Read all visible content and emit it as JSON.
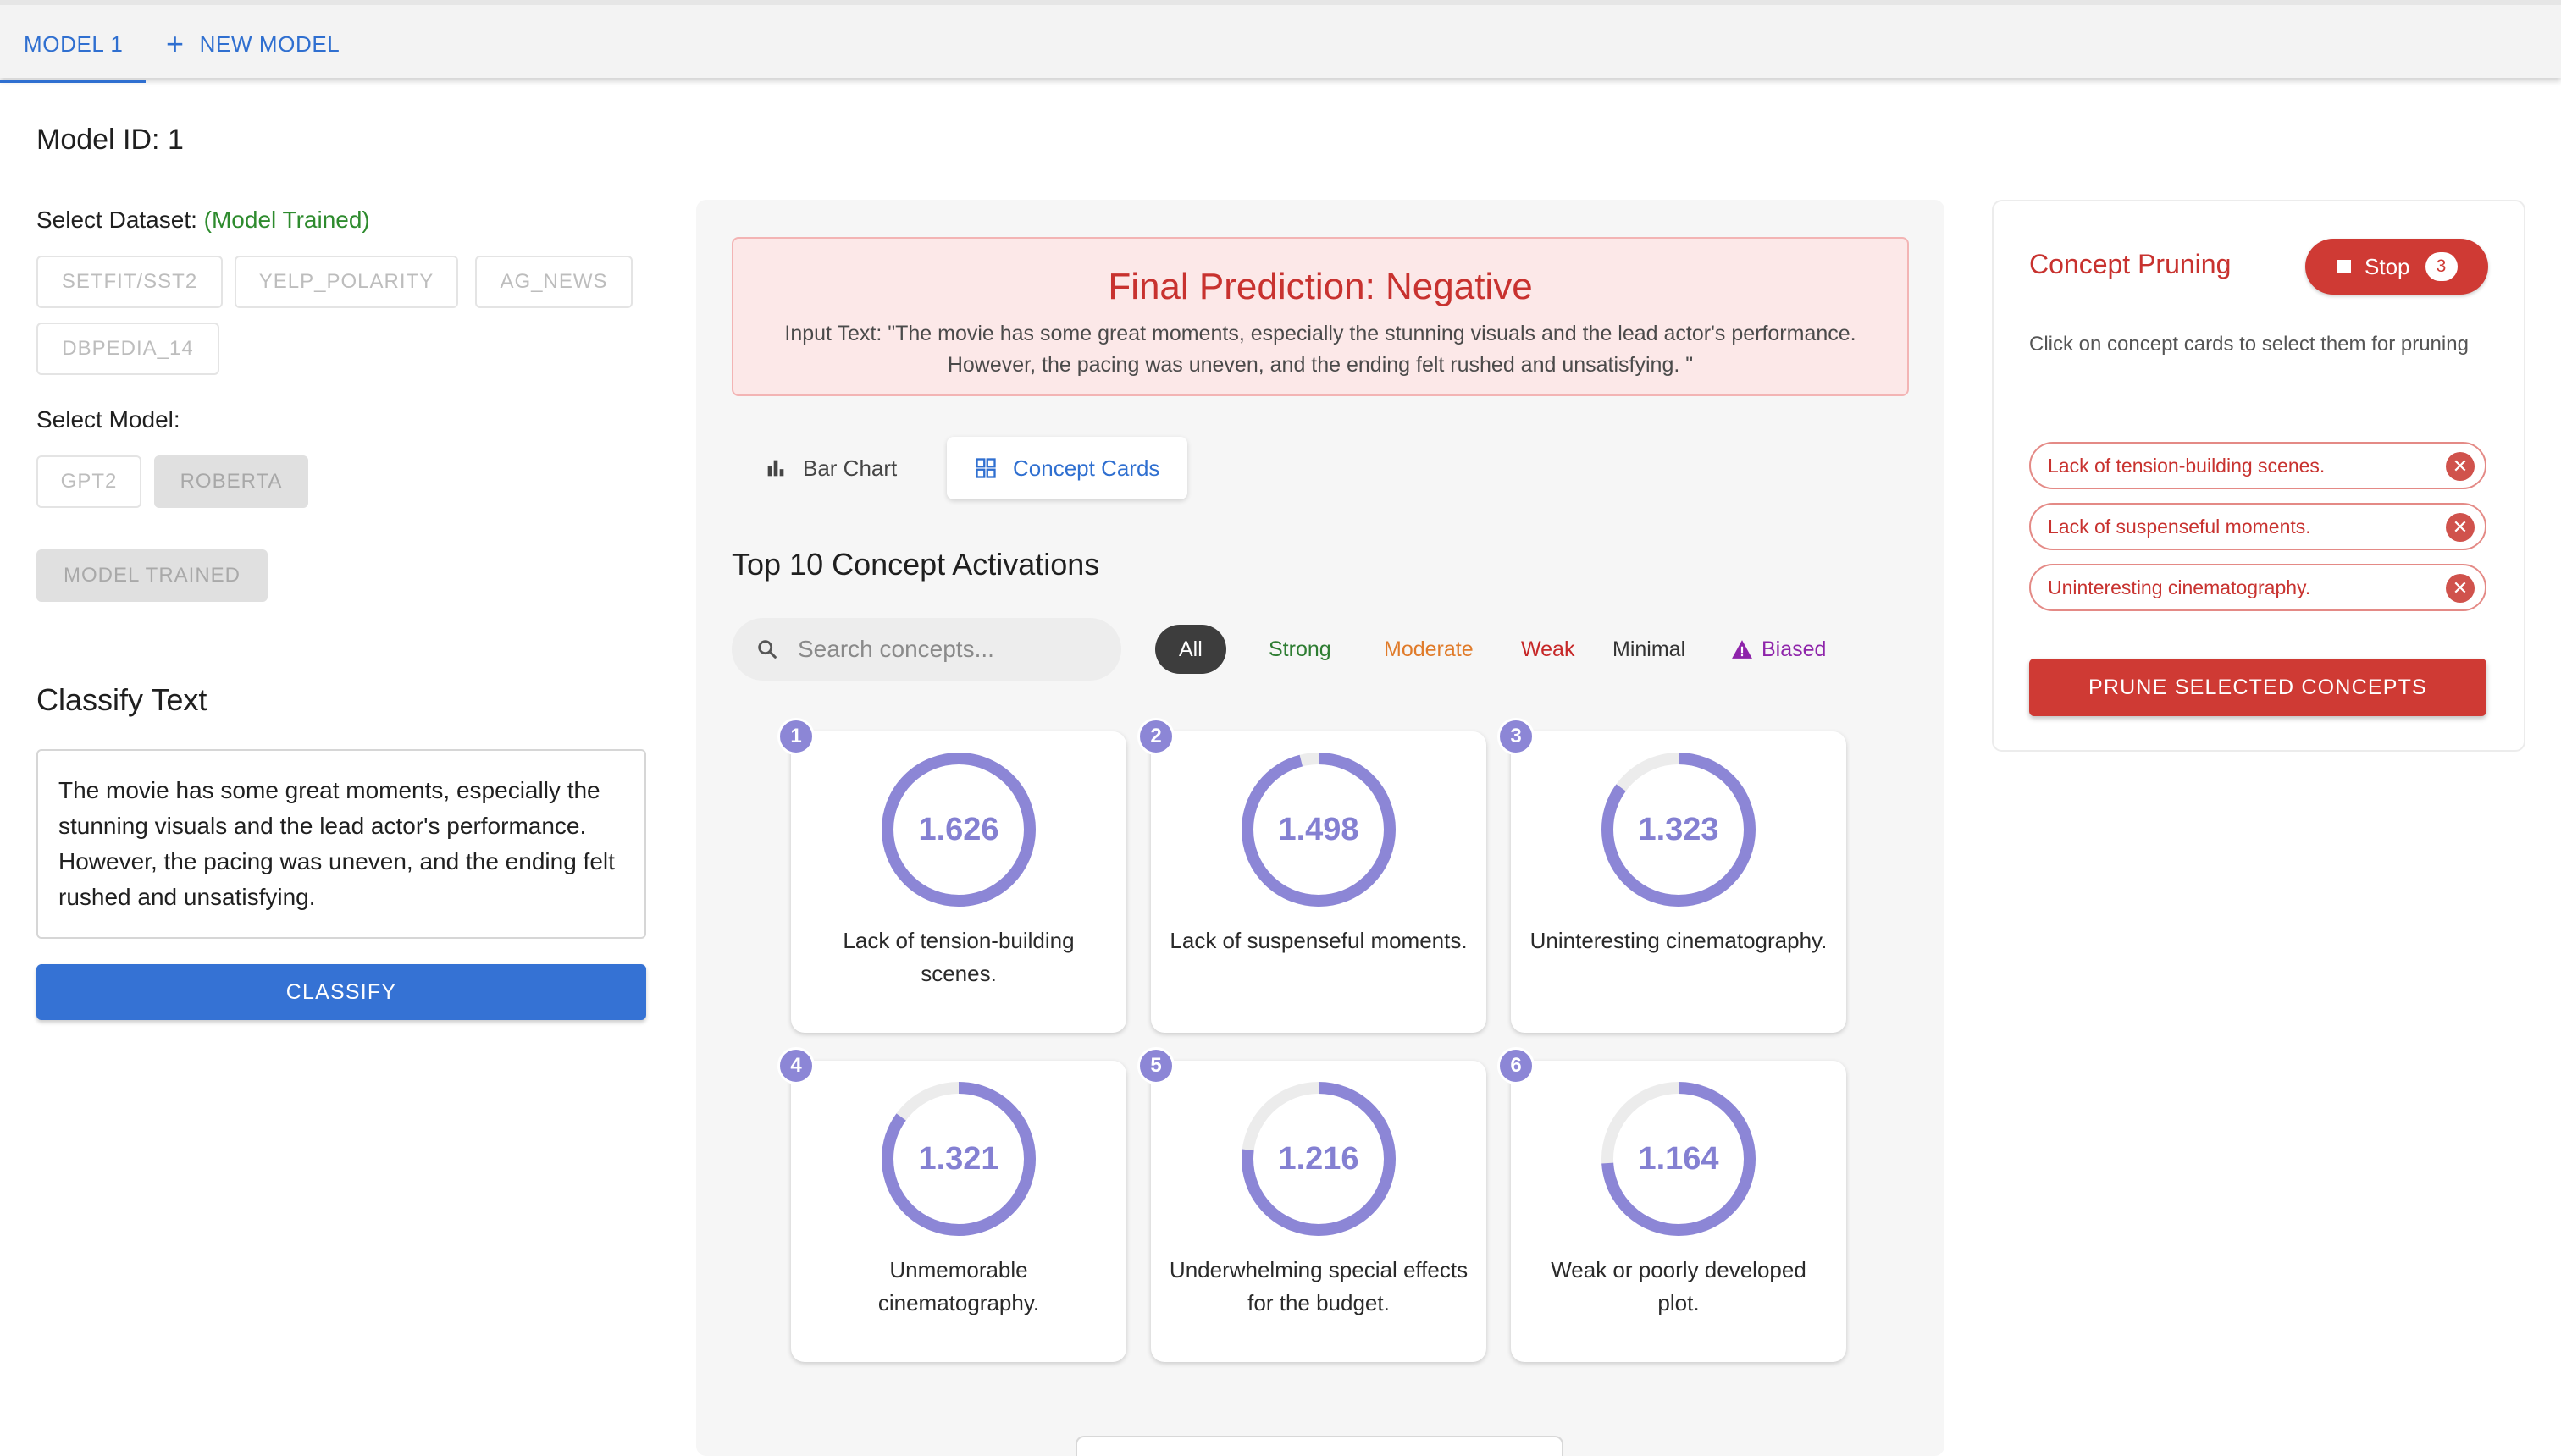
{
  "tabs": [
    {
      "label": "MODEL 1"
    },
    {
      "label": "NEW MODEL",
      "icon": "plus-icon"
    }
  ],
  "model": {
    "id_label": "Model ID: 1",
    "dataset_label": "Select Dataset:",
    "dataset_status": "(Model Trained)",
    "datasets": [
      "SETFIT/SST2",
      "YELP_POLARITY",
      "AG_NEWS",
      "DBPEDIA_14"
    ],
    "model_label": "Select Model:",
    "models": [
      "GPT2",
      "ROBERTA"
    ],
    "selected_model": "ROBERTA",
    "trained_button": "MODEL TRAINED"
  },
  "classify": {
    "title": "Classify Text",
    "input_text": "The movie has some great moments, especially the stunning visuals and the lead actor's performance. However, the pacing was uneven, and the ending felt rushed and unsatisfying.",
    "button": "CLASSIFY"
  },
  "prediction": {
    "title": "Final Prediction: Negative",
    "input_text": "Input Text: \"The movie has some great moments, especially the stunning visuals and the lead actor's performance. However, the pacing was uneven, and the ending felt rushed and unsatisfying. \""
  },
  "view_toggle": {
    "bar_chart": "Bar Chart",
    "concept_cards": "Concept Cards",
    "active": "Concept Cards"
  },
  "concepts": {
    "title": "Top 10 Concept Activations",
    "search_placeholder": "Search concepts...",
    "filters": {
      "all": "All",
      "strong": "Strong",
      "moderate": "Moderate",
      "weak": "Weak",
      "minimal": "Minimal",
      "biased": "Biased"
    },
    "active_filter": "All",
    "ring_color": "#8c86d6",
    "cards": [
      {
        "rank": "1",
        "value": "1.626",
        "fill": 1.0,
        "label": "Lack of tension-building scenes."
      },
      {
        "rank": "2",
        "value": "1.498",
        "fill": 0.96,
        "label": "Lack of suspenseful moments."
      },
      {
        "rank": "3",
        "value": "1.323",
        "fill": 0.85,
        "label": "Uninteresting cinematography."
      },
      {
        "rank": "4",
        "value": "1.321",
        "fill": 0.85,
        "label": "Unmemorable cinematography."
      },
      {
        "rank": "5",
        "value": "1.216",
        "fill": 0.77,
        "label": "Underwhelming special effects for the budget."
      },
      {
        "rank": "6",
        "value": "1.164",
        "fill": 0.74,
        "label": "Weak or poorly developed plot."
      }
    ]
  },
  "pruning": {
    "title": "Concept Pruning",
    "stop_label": "Stop",
    "stop_count": "3",
    "help": "Click on concept cards to select them for pruning",
    "selected": [
      "Lack of tension-building scenes.",
      "Lack of suspenseful moments.",
      "Uninteresting cinematography."
    ],
    "button": "PRUNE SELECTED CONCEPTS"
  }
}
